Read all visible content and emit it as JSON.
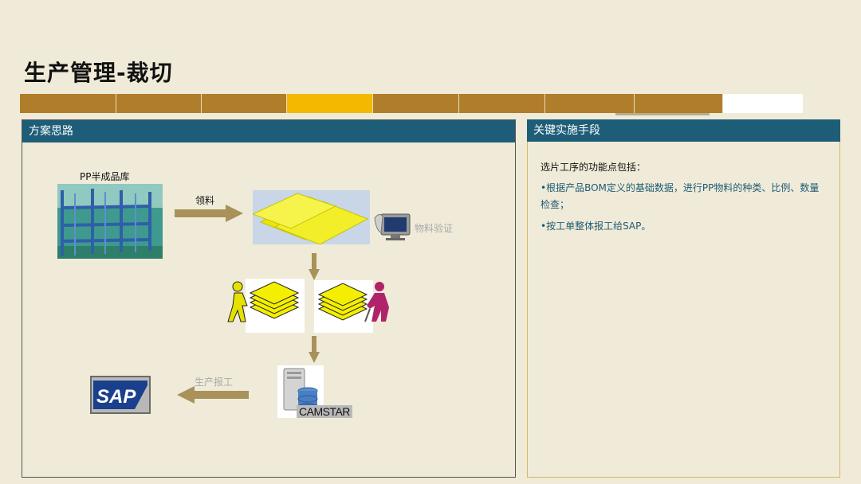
{
  "title": "生产管理-裁切",
  "progress": {
    "segments": 9,
    "active_index": 3
  },
  "left_panel": {
    "header": "方案思路",
    "warehouse_label": "PP半成品库",
    "pick_label": "领料",
    "verify_label": "物料验证",
    "report_label": "生产报工",
    "camstar_label": "CAMSTAR",
    "sap_label": "SAP"
  },
  "right_panel": {
    "header": "关键实施手段",
    "intro": "选片工序的功能点包括：",
    "points": [
      "•根据产品BOM定义的基础数据，进行PP物料的种类、比例、数量检查；",
      "•按工单整体报工给SAP。"
    ]
  },
  "colors": {
    "accent_bar": "#b07d2a",
    "active_segment": "#f4b800",
    "header_bg": "#1e5d78",
    "arrow": "#a8925a",
    "bullet_text": "#1f5a75"
  },
  "icons": [
    "shelf-image",
    "monitor-icon",
    "person-icon",
    "database-server-icon",
    "sap-logo"
  ]
}
